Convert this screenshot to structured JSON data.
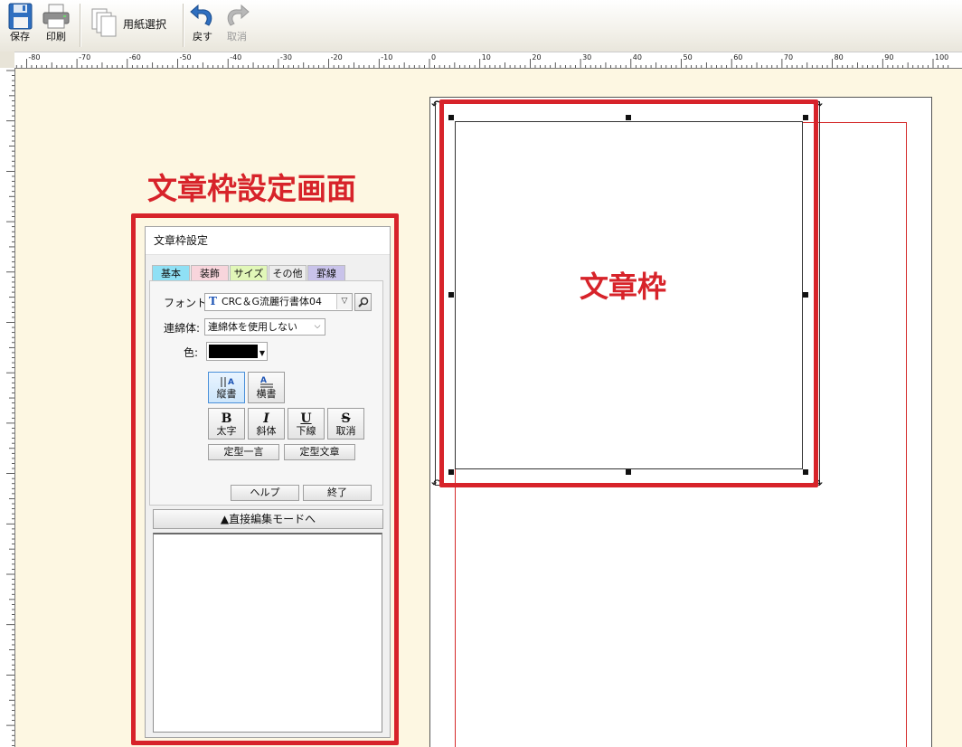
{
  "toolbar": {
    "save_label": "保存",
    "print_label": "印刷",
    "paper_select_label": "用紙選択",
    "undo_label": "戻す",
    "redo_label": "取消"
  },
  "ruler": {
    "top_labels": [
      "-80",
      "-70",
      "-60",
      "-50",
      "-40",
      "-30",
      "-20",
      "-10",
      "0",
      "10",
      "20",
      "30",
      "40",
      "50",
      "60",
      "70",
      "80",
      "90",
      "100"
    ]
  },
  "annotations": {
    "dialog_title": "文章枠設定画面",
    "frame_title": "文章枠"
  },
  "dialog": {
    "title": "文章枠設定",
    "tabs": [
      {
        "label": "基本",
        "color": "#8fe0f5"
      },
      {
        "label": "装飾",
        "color": "#f8d5dc"
      },
      {
        "label": "サイズ",
        "color": "#e1f7b8"
      },
      {
        "label": "その他",
        "color": "#ececec"
      },
      {
        "label": "罫線",
        "color": "#c9c3ea"
      }
    ],
    "font_label": "フォント:",
    "font_value": "CRC＆G流麗行書体04",
    "font_icon_text": "T",
    "connect_label": "連綿体:",
    "connect_value": "連綿体を使用しない",
    "color_label": "色:",
    "color_value": "#000000",
    "vertical_label": "縦書",
    "horizontal_label": "横書",
    "bold_glyph": "B",
    "bold_label": "太字",
    "italic_glyph": "I",
    "italic_label": "斜体",
    "underline_glyph": "U",
    "underline_label": "下線",
    "strike_glyph": "S",
    "strike_label": "取消",
    "phrase_label": "定型一言",
    "sentence_label": "定型文章",
    "help_label": "ヘルプ",
    "close_label": "終了",
    "direct_edit_label": "▲直接編集モードへ",
    "text_value": ""
  },
  "colors": {
    "annotation_red": "#d7232a",
    "margin_red": "#d42a2a"
  }
}
